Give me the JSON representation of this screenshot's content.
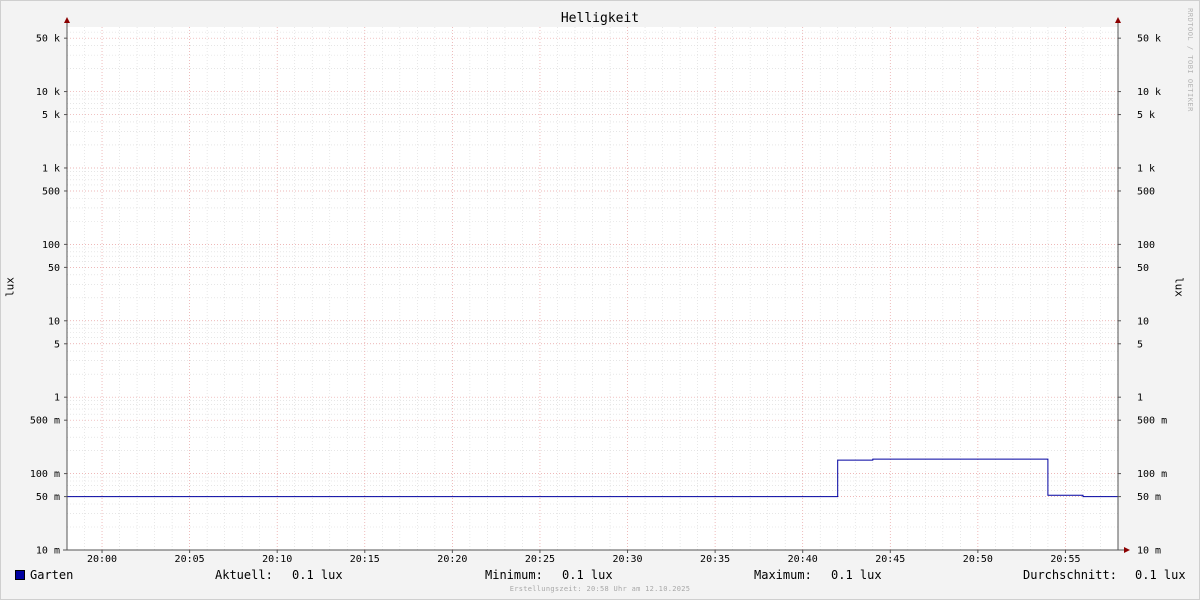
{
  "chart_data": {
    "type": "line",
    "title": "Helligkeit",
    "ylabel": "lux",
    "yscale": "log",
    "ylim": [
      0.01,
      70000
    ],
    "x_ticks": [
      "20:00",
      "20:05",
      "20:10",
      "20:15",
      "20:20",
      "20:25",
      "20:30",
      "20:35",
      "20:40",
      "20:45",
      "20:50",
      "20:55"
    ],
    "y_ticks": [
      {
        "value": 0.01,
        "label": "10 m"
      },
      {
        "value": 0.05,
        "label": "50 m"
      },
      {
        "value": 0.1,
        "label": "100 m"
      },
      {
        "value": 0.5,
        "label": "500 m"
      },
      {
        "value": 1,
        "label": "1"
      },
      {
        "value": 5,
        "label": "5"
      },
      {
        "value": 10,
        "label": "10"
      },
      {
        "value": 50,
        "label": "50"
      },
      {
        "value": 100,
        "label": "100"
      },
      {
        "value": 500,
        "label": "500"
      },
      {
        "value": 1000,
        "label": "1 k"
      },
      {
        "value": 5000,
        "label": "5 k"
      },
      {
        "value": 10000,
        "label": "10 k"
      },
      {
        "value": 50000,
        "label": "50 k"
      }
    ],
    "x_range": [
      "19:58",
      "20:58"
    ],
    "grid": true,
    "legend_position": "bottom",
    "series": [
      {
        "name": "Garten",
        "color": "#0000a0",
        "x": [
          "19:58",
          "20:42",
          "20:42",
          "20:44",
          "20:44",
          "20:54",
          "20:54",
          "20:56",
          "20:56",
          "20:58"
        ],
        "values": [
          0.05,
          0.05,
          0.15,
          0.15,
          0.155,
          0.155,
          0.052,
          0.052,
          0.05,
          0.05
        ]
      }
    ]
  },
  "legend": {
    "series_name": "Garten",
    "current_label": "Aktuell:",
    "current_value": "0.1 lux",
    "min_label": "Minimum:",
    "min_value": "0.1 lux",
    "max_label": "Maximum:",
    "max_value": "0.1 lux",
    "avg_label": "Durchschnitt:",
    "avg_value": "0.1 lux"
  },
  "footer": "Erstellungszeit: 20:58 Uhr am 12.10.2025",
  "watermark": "RRDTOOL / TOBI OETIKER",
  "colors": {
    "background": "#f3f3f3",
    "canvas": "#ffffff",
    "series": "#0000a0",
    "major_grid": "#e8a0a0",
    "minor_grid": "#d8d8d8"
  }
}
